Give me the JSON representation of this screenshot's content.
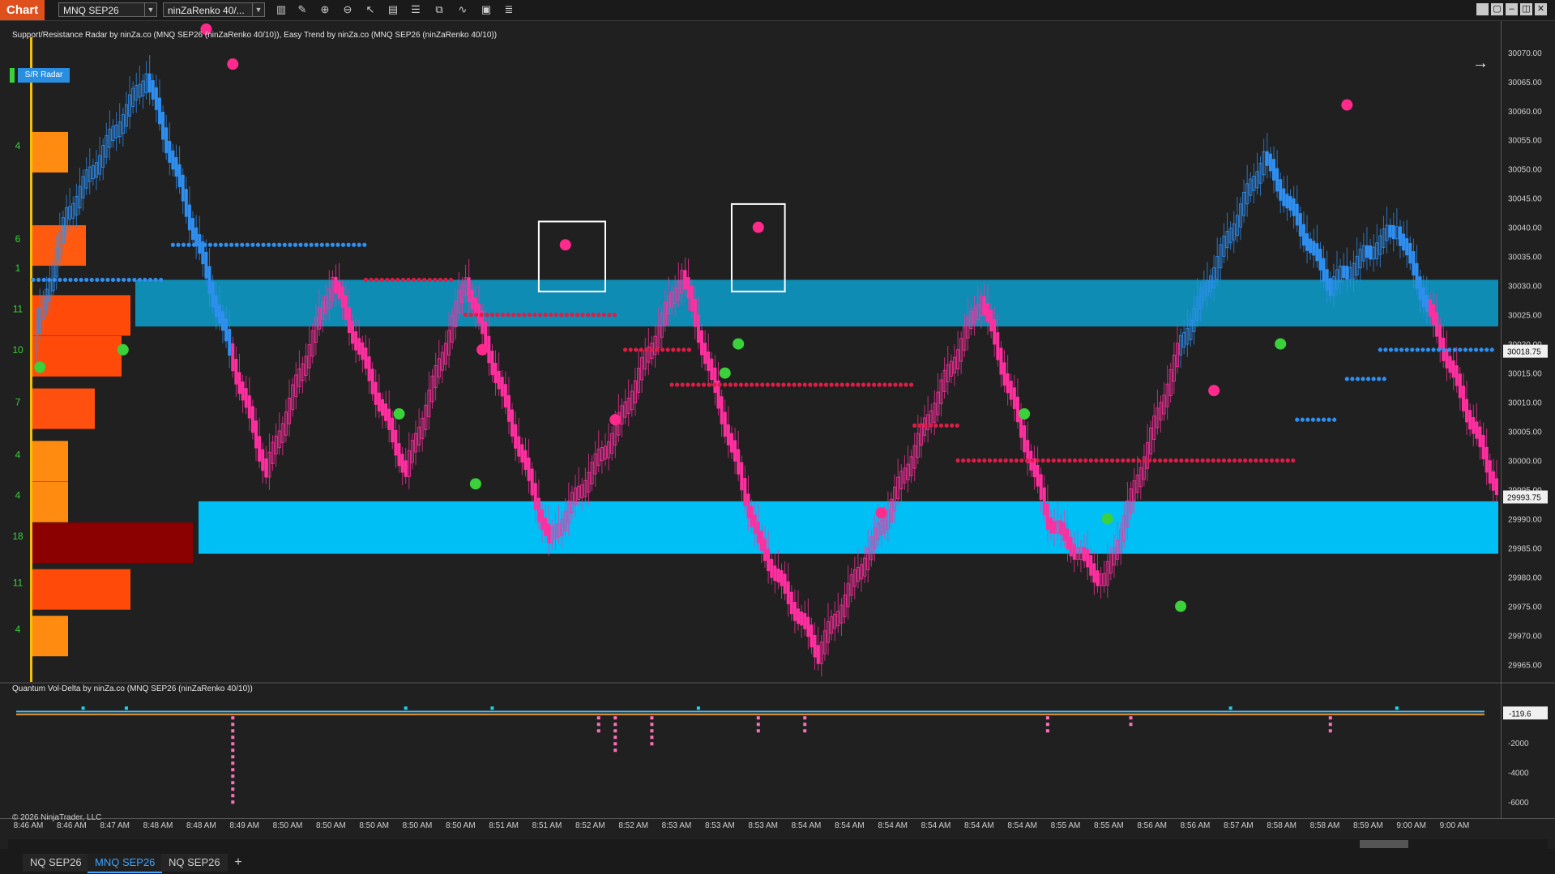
{
  "toolbar": {
    "chart_label": "Chart",
    "instrument": "MNQ SEP26",
    "bar_type": "ninZaRenko 40/...",
    "icons": [
      "bars-icon",
      "pencil-icon",
      "zoom-in-icon",
      "zoom-out-icon",
      "pointer-icon",
      "data-box-icon",
      "properties-icon",
      "strategies-icon",
      "indicators-icon",
      "templates-icon",
      "list-icon"
    ],
    "window_buttons": [
      "tile-icon",
      "restore-icon",
      "minimize-icon",
      "maximize-icon",
      "close-icon"
    ]
  },
  "indicators": {
    "top_label": "Support/Resistance Radar by ninZa.co (MNQ SEP26 (ninZaRenko 40/10)), Easy Trend by ninZa.co (MNQ SEP26 (ninZaRenko 40/10))",
    "sr_radar_button": "S/R Radar",
    "bottom_label": "Quantum Vol-Delta by ninZa.co (MNQ SEP26 (ninZaRenko 40/10))"
  },
  "price_axis": {
    "labels": [
      "30070.00",
      "30065.00",
      "30060.00",
      "30055.00",
      "30050.00",
      "30045.00",
      "30040.00",
      "30035.00",
      "30030.00",
      "30025.00",
      "30020.00",
      "30015.00",
      "30010.00",
      "30005.00",
      "30000.00",
      "29995.00",
      "29990.00",
      "29985.00",
      "29980.00",
      "29975.00",
      "29970.00",
      "29965.00"
    ],
    "current_price": "30018.75",
    "last_price": "29993.75"
  },
  "volume_axis": {
    "labels": [
      "-2000",
      "-4000",
      "-6000"
    ],
    "current_value": "-119.6"
  },
  "time_axis": {
    "labels": [
      "8:46 AM",
      "8:46 AM",
      "8:47 AM",
      "8:48 AM",
      "8:48 AM",
      "8:49 AM",
      "8:50 AM",
      "8:50 AM",
      "8:50 AM",
      "8:50 AM",
      "8:50 AM",
      "8:51 AM",
      "8:51 AM",
      "8:52 AM",
      "8:52 AM",
      "8:53 AM",
      "8:53 AM",
      "8:53 AM",
      "8:54 AM",
      "8:54 AM",
      "8:54 AM",
      "8:54 AM",
      "8:54 AM",
      "8:54 AM",
      "8:55 AM",
      "8:55 AM",
      "8:56 AM",
      "8:56 AM",
      "8:57 AM",
      "8:58 AM",
      "8:58 AM",
      "8:59 AM",
      "9:00 AM",
      "9:00 AM"
    ]
  },
  "volume_profile": {
    "counts": [
      "4",
      "6",
      "1",
      "11",
      "10",
      "7",
      "4",
      "4",
      "18",
      "11",
      "4"
    ],
    "count_prices": [
      30054,
      30038,
      30033,
      30026,
      30019,
      30010,
      30001,
      29994,
      29987,
      29979,
      29971
    ]
  },
  "copyright": "© 2026 NinjaTrader, LLC",
  "tabs": [
    {
      "label": "NQ SEP26",
      "active": false
    },
    {
      "label": "MNQ SEP26",
      "active": true
    },
    {
      "label": "NQ SEP26",
      "active": false
    }
  ],
  "tab_add": "+",
  "colors": {
    "background": "#202020",
    "bull": "#2f8ff0",
    "bear": "#ff2fa0",
    "resistance_zone": "#0f8cb4",
    "support_zone": "#00bff5",
    "signal_up": "#3ad13a",
    "signal_down": "#ff2a8c",
    "sr_red": "#e01c46",
    "sr_blue": "#2f8ff0"
  },
  "chart_data": {
    "type": "renko-candlestick",
    "instrument": "MNQ SEP26",
    "bar_type": "ninZaRenko 40/10",
    "ylim": [
      29962,
      30074
    ],
    "zones": [
      {
        "name": "resistance",
        "from": 30023,
        "to": 30031
      },
      {
        "name": "support",
        "from": 29984,
        "to": 29993
      }
    ],
    "price_pivots": [
      {
        "bar": 0,
        "price": 30020
      },
      {
        "bar": 10,
        "price": 30042
      },
      {
        "bar": 34,
        "price": 30066
      },
      {
        "bar": 70,
        "price": 29998
      },
      {
        "bar": 90,
        "price": 30031
      },
      {
        "bar": 112,
        "price": 29998
      },
      {
        "bar": 130,
        "price": 30031
      },
      {
        "bar": 155,
        "price": 29986
      },
      {
        "bar": 175,
        "price": 30005
      },
      {
        "bar": 195,
        "price": 30032
      },
      {
        "bar": 218,
        "price": 29986
      },
      {
        "bar": 236,
        "price": 29967
      },
      {
        "bar": 256,
        "price": 29990
      },
      {
        "bar": 285,
        "price": 30028
      },
      {
        "bar": 305,
        "price": 29990
      },
      {
        "bar": 322,
        "price": 29979
      },
      {
        "bar": 345,
        "price": 30020
      },
      {
        "bar": 370,
        "price": 30052
      },
      {
        "bar": 390,
        "price": 30030
      },
      {
        "bar": 410,
        "price": 30040
      },
      {
        "bar": 440,
        "price": 29995
      }
    ],
    "trend_flips": [
      {
        "bar": 60,
        "trend": "down"
      },
      {
        "bar": 345,
        "trend": "up"
      },
      {
        "bar": 420,
        "trend": "down"
      }
    ],
    "sr_lines": [
      {
        "price": 30037,
        "bar_from": 42,
        "bar_to": 100,
        "type": "support"
      },
      {
        "price": 30031,
        "bar_from": 0,
        "bar_to": 40,
        "type": "support"
      },
      {
        "price": 30031,
        "bar_from": 100,
        "bar_to": 127,
        "type": "resistance"
      },
      {
        "price": 30025,
        "bar_from": 130,
        "bar_to": 175,
        "type": "resistance"
      },
      {
        "price": 30019,
        "bar_from": 178,
        "bar_to": 198,
        "type": "resistance"
      },
      {
        "price": 30013,
        "bar_from": 192,
        "bar_to": 265,
        "type": "resistance"
      },
      {
        "price": 30006,
        "bar_from": 265,
        "bar_to": 278,
        "type": "resistance"
      },
      {
        "price": 30000,
        "bar_from": 278,
        "bar_to": 380,
        "type": "resistance"
      },
      {
        "price": 30019,
        "bar_from": 405,
        "bar_to": 440,
        "type": "support"
      },
      {
        "price": 30014,
        "bar_from": 395,
        "bar_to": 407,
        "type": "support"
      },
      {
        "price": 30007,
        "bar_from": 380,
        "bar_to": 392,
        "type": "support"
      }
    ],
    "signals": [
      {
        "bar": 2,
        "price": 30016,
        "type": "up"
      },
      {
        "bar": 27,
        "price": 30019,
        "type": "up"
      },
      {
        "bar": 52,
        "price": 30074,
        "type": "down"
      },
      {
        "bar": 60,
        "price": 30068,
        "type": "down"
      },
      {
        "bar": 110,
        "price": 30008,
        "type": "up"
      },
      {
        "bar": 135,
        "price": 30019,
        "type": "down"
      },
      {
        "bar": 133,
        "price": 29996,
        "type": "up"
      },
      {
        "bar": 160,
        "price": 30037,
        "type": "down"
      },
      {
        "bar": 175,
        "price": 30007,
        "type": "down"
      },
      {
        "bar": 208,
        "price": 30015,
        "type": "up"
      },
      {
        "bar": 212,
        "price": 30020,
        "type": "up"
      },
      {
        "bar": 218,
        "price": 30040,
        "type": "down"
      },
      {
        "bar": 255,
        "price": 29991,
        "type": "down"
      },
      {
        "bar": 298,
        "price": 30008,
        "type": "up"
      },
      {
        "bar": 323,
        "price": 29990,
        "type": "up"
      },
      {
        "bar": 345,
        "price": 29975,
        "type": "up"
      },
      {
        "bar": 355,
        "price": 30012,
        "type": "down"
      },
      {
        "bar": 375,
        "price": 30020,
        "type": "up"
      },
      {
        "bar": 395,
        "price": 30061,
        "type": "down"
      }
    ],
    "highlight_boxes": [
      {
        "bar_from": 152,
        "bar_to": 172,
        "price_top": 30041,
        "price_bottom": 30029
      },
      {
        "bar_from": 210,
        "bar_to": 226,
        "price_top": 30044,
        "price_bottom": 30029
      }
    ],
    "volume_profile_rows": [
      {
        "price": 30054,
        "volume": 4
      },
      {
        "price": 30038,
        "volume": 6
      },
      {
        "price": 30026,
        "volume": 11
      },
      {
        "price": 30019,
        "volume": 10
      },
      {
        "price": 30010,
        "volume": 7
      },
      {
        "price": 30001,
        "volume": 4
      },
      {
        "price": 29994,
        "volume": 4
      },
      {
        "price": 29987,
        "volume": 18
      },
      {
        "price": 29979,
        "volume": 11
      },
      {
        "price": 29971,
        "volume": 4
      }
    ],
    "vol_delta": {
      "ylim": [
        -7000,
        1000
      ],
      "spikes": [
        {
          "bar": 15,
          "value": 600
        },
        {
          "bar": 28,
          "value": 500
        },
        {
          "bar": 60,
          "value": -6200
        },
        {
          "bar": 112,
          "value": 600
        },
        {
          "bar": 138,
          "value": 500
        },
        {
          "bar": 170,
          "value": -1200
        },
        {
          "bar": 175,
          "value": -2500
        },
        {
          "bar": 186,
          "value": -2200
        },
        {
          "bar": 200,
          "value": 600
        },
        {
          "bar": 218,
          "value": -1400
        },
        {
          "bar": 232,
          "value": -1200
        },
        {
          "bar": 305,
          "value": -1300
        },
        {
          "bar": 330,
          "value": -800
        },
        {
          "bar": 360,
          "value": 400
        },
        {
          "bar": 390,
          "value": -1500
        },
        {
          "bar": 410,
          "value": 300
        }
      ]
    }
  }
}
